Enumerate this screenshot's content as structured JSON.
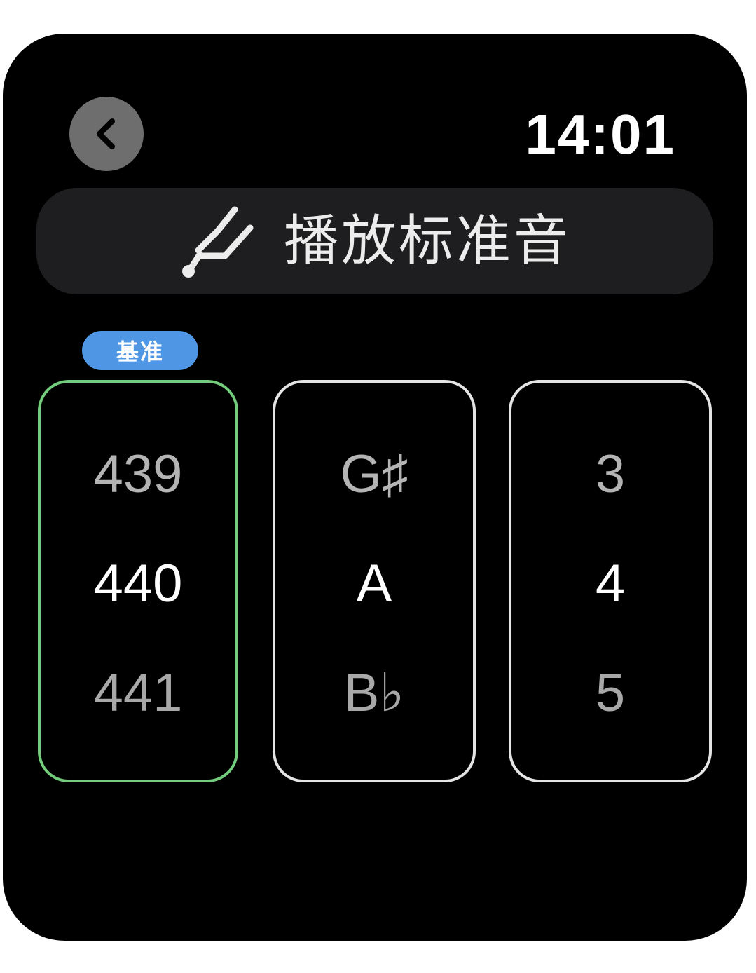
{
  "status": {
    "time": "14:01"
  },
  "header": {
    "back_icon": "chevron-left-icon"
  },
  "play_button": {
    "icon": "tuning-fork-icon",
    "label": "播放标准音"
  },
  "reference_badge": {
    "label": "基准",
    "color": "#4f97e4"
  },
  "pickers": [
    {
      "name": "frequency",
      "options": [
        "439",
        "440",
        "441"
      ],
      "selected": "440",
      "border_color": "#73cd7d"
    },
    {
      "name": "note",
      "options": [
        "G♯",
        "A",
        "B♭"
      ],
      "selected": "A",
      "border_color": "#e4e4e4"
    },
    {
      "name": "octave",
      "options": [
        "3",
        "4",
        "5"
      ],
      "selected": "4",
      "border_color": "#e4e4e4"
    }
  ]
}
